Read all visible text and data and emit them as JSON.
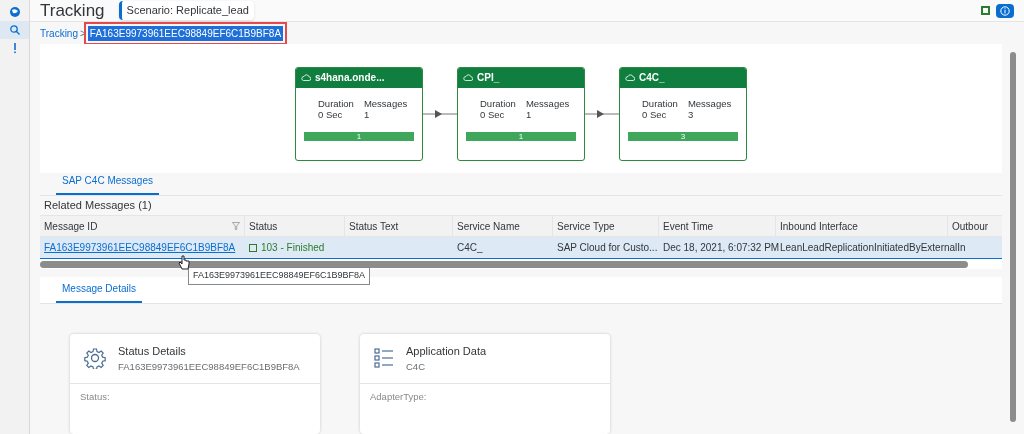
{
  "header": {
    "title": "Tracking",
    "scenario": "Scenario: Replicate_lead"
  },
  "sidebar": {
    "items": [
      {
        "selected": false
      },
      {
        "selected": true
      },
      {
        "selected": false
      }
    ]
  },
  "breadcrumb": {
    "link": "Tracking",
    "separator": ">",
    "current": "FA163E9973961EEC98849EF6C1B9BF8A"
  },
  "flow": [
    {
      "title": "s4hana.onde...",
      "duration_label": "Duration",
      "duration": "0 Sec",
      "messages_label": "Messages",
      "messages": "1",
      "bar": "1"
    },
    {
      "title": "CPI_",
      "duration_label": "Duration",
      "duration": "0 Sec",
      "messages_label": "Messages",
      "messages": "1",
      "bar": "1"
    },
    {
      "title": "C4C_",
      "duration_label": "Duration",
      "duration": "0 Sec",
      "messages_label": "Messages",
      "messages": "3",
      "bar": "3"
    }
  ],
  "tabs": [
    {
      "label": "SAP C4C Messages",
      "selected": true
    }
  ],
  "table": {
    "title": "Related Messages (1)",
    "columns": [
      "Message ID",
      "Status",
      "Status Text",
      "Service Name",
      "Service Type",
      "Event Time",
      "Inbound Interface",
      "Outbour"
    ],
    "rows": [
      {
        "selected": true,
        "message_id": "FA163E9973961EEC98849EF6C1B9BF8A",
        "status": "103 - Finished",
        "service_name": "C4C_",
        "service_type": "SAP Cloud for Custo...",
        "event_time": "Dec 18, 2021, 6:07:32 PM",
        "inbound_interface": "LeanLeadReplicationInitiatedByExternalIn"
      }
    ]
  },
  "tooltip": "FA163E9973961EEC98849EF6C1B9BF8A",
  "detail_tabs": [
    {
      "label": "Message Details",
      "selected": true
    }
  ],
  "cards": [
    {
      "title": "Status Details",
      "subtitle": "FA163E9973961EEC98849EF6C1B9BF8A",
      "field": "Status:"
    },
    {
      "title": "Application Data",
      "subtitle": "C4C",
      "field": "AdapterType:"
    }
  ]
}
